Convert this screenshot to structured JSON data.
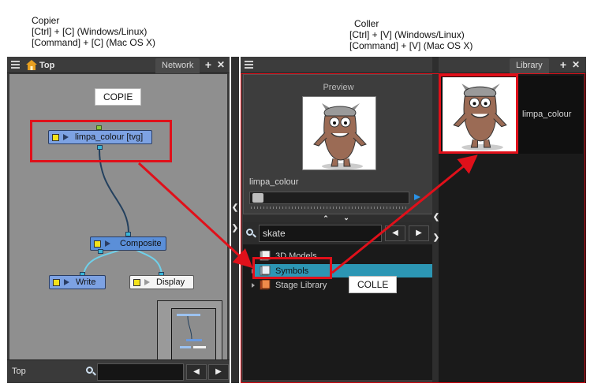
{
  "captions": {
    "copy_title": "Copier",
    "copy_line1": "[Ctrl] + [C] (Windows/Linux)",
    "copy_line2": "[Command] + [C] (Mac OS X)",
    "paste_title": "Coller",
    "paste_line1": "[Ctrl] + [V] (Windows/Linux)",
    "paste_line2": "[Command] + [V] (Mac OS X)"
  },
  "node_view": {
    "breadcrumb": "Top",
    "tab_label": "Network",
    "add_button": "+",
    "close_button": "✕",
    "copy_label": "COPIE",
    "nodes": {
      "source": "limpa_colour  [tvg]",
      "composite": "Composite",
      "write": "Write",
      "display": "Display"
    },
    "status": "Top",
    "search_value": "",
    "prev_label": "◀",
    "next_label": "▶"
  },
  "library": {
    "tab_label": "Library",
    "add_button": "+",
    "close_button": "✕",
    "preview_title": "Preview",
    "preview_name": "limpa_colour",
    "search_value": "skate",
    "prev_label": "◀",
    "next_label": "▶",
    "paste_label": "COLLE",
    "tree": [
      {
        "label": "3D Models"
      },
      {
        "label": "Symbols"
      },
      {
        "label": "Stage Library"
      }
    ],
    "grid_item_label": "limpa_colour"
  },
  "colors": {
    "highlight": "#e0101a",
    "selection": "#2c96b4",
    "node_blue": "#5b8fd8",
    "accent_play": "#2a93e8"
  }
}
